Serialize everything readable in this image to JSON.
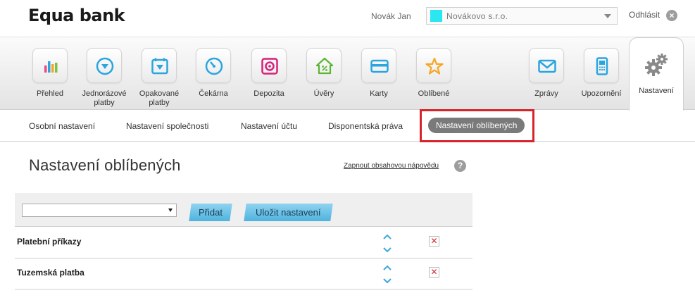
{
  "brand": {
    "name": "Equa bank"
  },
  "header": {
    "user_name": "Novák Jan",
    "company": "Novákovo s.r.o.",
    "company_color": "#29e6f0",
    "logout_label": "Odhlásit"
  },
  "nav": {
    "items": [
      {
        "label": "Přehled",
        "icon": "bar-chart-icon"
      },
      {
        "label": "Jednorázové platby",
        "icon": "arrow-down-circle-icon"
      },
      {
        "label": "Opakované platby",
        "icon": "calendar-icon"
      },
      {
        "label": "Čekárna",
        "icon": "clock-icon"
      },
      {
        "label": "Depozita",
        "icon": "safe-icon"
      },
      {
        "label": "Úvěry",
        "icon": "house-percent-icon"
      },
      {
        "label": "Karty",
        "icon": "card-icon"
      },
      {
        "label": "Oblíbené",
        "icon": "star-icon"
      },
      {
        "label": "Zprávy",
        "icon": "envelope-icon"
      },
      {
        "label": "Upozornění",
        "icon": "phone-icon"
      }
    ],
    "active": {
      "label": "Nastavení",
      "icon": "gears-icon"
    }
  },
  "subtabs": {
    "items": [
      "Osobní nastavení",
      "Nastavení společnosti",
      "Nastavení účtu",
      "Disponentská práva"
    ],
    "active": "Nastavení oblíbených"
  },
  "main": {
    "title": "Nastavení oblíbených",
    "help_link": "Zapnout obsahovou nápovědu",
    "select_value": "",
    "add_button": "Přidat",
    "save_button": "Uložit nastavení",
    "rows": [
      {
        "name": "Platební příkazy"
      },
      {
        "name": "Tuzemská platba"
      }
    ]
  },
  "colors": {
    "accent_button": "#4fb3df",
    "highlight_border": "#d8232a",
    "active_pill": "#7a7a7a"
  }
}
